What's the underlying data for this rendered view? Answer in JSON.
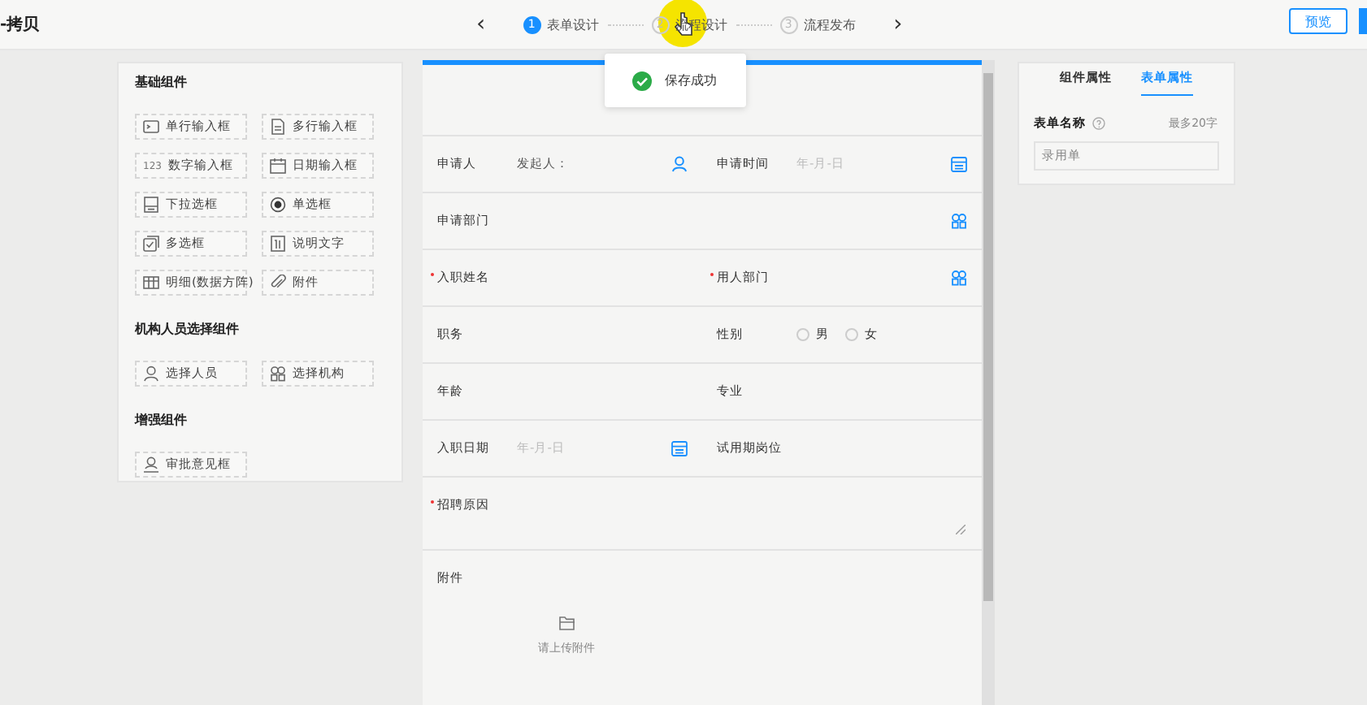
{
  "header": {
    "title": "-拷贝",
    "prev": "‹",
    "next": "›",
    "steps": [
      {
        "number": "1",
        "label": "表单设计",
        "selected": true
      },
      {
        "number": "2",
        "label": "流程设计",
        "selected": false
      },
      {
        "number": "3",
        "label": "流程发布",
        "selected": false
      }
    ],
    "preview_button": "预览"
  },
  "palette": [
    {
      "title": "基础组件",
      "items": [
        {
          "label": "单行输入框",
          "kind": "input"
        },
        {
          "label": "多行输入框",
          "kind": "textarea"
        },
        {
          "label": "数字输入框",
          "kind": "number",
          "icon_text": "123"
        },
        {
          "label": "日期输入框",
          "kind": "date"
        },
        {
          "label": "下拉选框",
          "kind": "select"
        },
        {
          "label": "单选框",
          "kind": "radio"
        },
        {
          "label": "多选框",
          "kind": "checkbox"
        },
        {
          "label": "说明文字",
          "kind": "note"
        },
        {
          "label": "明细(数据方阵)",
          "kind": "table"
        },
        {
          "label": "附件",
          "kind": "attachment"
        }
      ]
    },
    {
      "title": "机构人员选择组件",
      "items": [
        {
          "label": "选择人员",
          "kind": "person"
        },
        {
          "label": "选择机构",
          "kind": "org"
        }
      ]
    },
    {
      "title": "增强组件",
      "items": [
        {
          "label": "审批意见框",
          "kind": "approval"
        }
      ]
    }
  ],
  "toast": {
    "text": "保存成功"
  },
  "form": {
    "rows": [
      {
        "cells": [
          {
            "label": "申请人",
            "kind": "person",
            "value": "发起人：",
            "required": false
          },
          {
            "label": "申请时间",
            "kind": "date",
            "placeholder": "年-月-日",
            "required": false
          }
        ]
      },
      {
        "cells": [
          {
            "label": "申请部门",
            "kind": "org",
            "required": false
          }
        ]
      },
      {
        "cells": [
          {
            "label": "入职姓名",
            "kind": "text",
            "required": true
          },
          {
            "label": "用人部门",
            "kind": "org",
            "required": true
          }
        ]
      },
      {
        "cells": [
          {
            "label": "职务",
            "kind": "text",
            "required": false
          },
          {
            "label": "性别",
            "kind": "radio",
            "required": false,
            "options": [
              {
                "label": "男",
                "selected": false
              },
              {
                "label": "女",
                "selected": false
              }
            ]
          }
        ]
      },
      {
        "cells": [
          {
            "label": "年龄",
            "kind": "text",
            "required": false
          },
          {
            "label": "专业",
            "kind": "text",
            "required": false
          }
        ]
      },
      {
        "cells": [
          {
            "label": "入职日期",
            "kind": "date",
            "placeholder": "年-月-日",
            "required": false
          },
          {
            "label": "试用期岗位",
            "kind": "text",
            "required": false
          }
        ]
      },
      {
        "cells": [
          {
            "label": "招聘原因",
            "kind": "textarea",
            "required": true
          }
        ]
      },
      {
        "cells": [
          {
            "label": "附件",
            "kind": "upload",
            "hint": "请上传附件",
            "required": false
          }
        ]
      }
    ]
  },
  "properties": {
    "tabs": [
      {
        "label": "组件属性",
        "selected": false
      },
      {
        "label": "表单属性",
        "selected": true
      }
    ],
    "field_label": "表单名称",
    "limit": "最多20字",
    "value": "录用单"
  }
}
